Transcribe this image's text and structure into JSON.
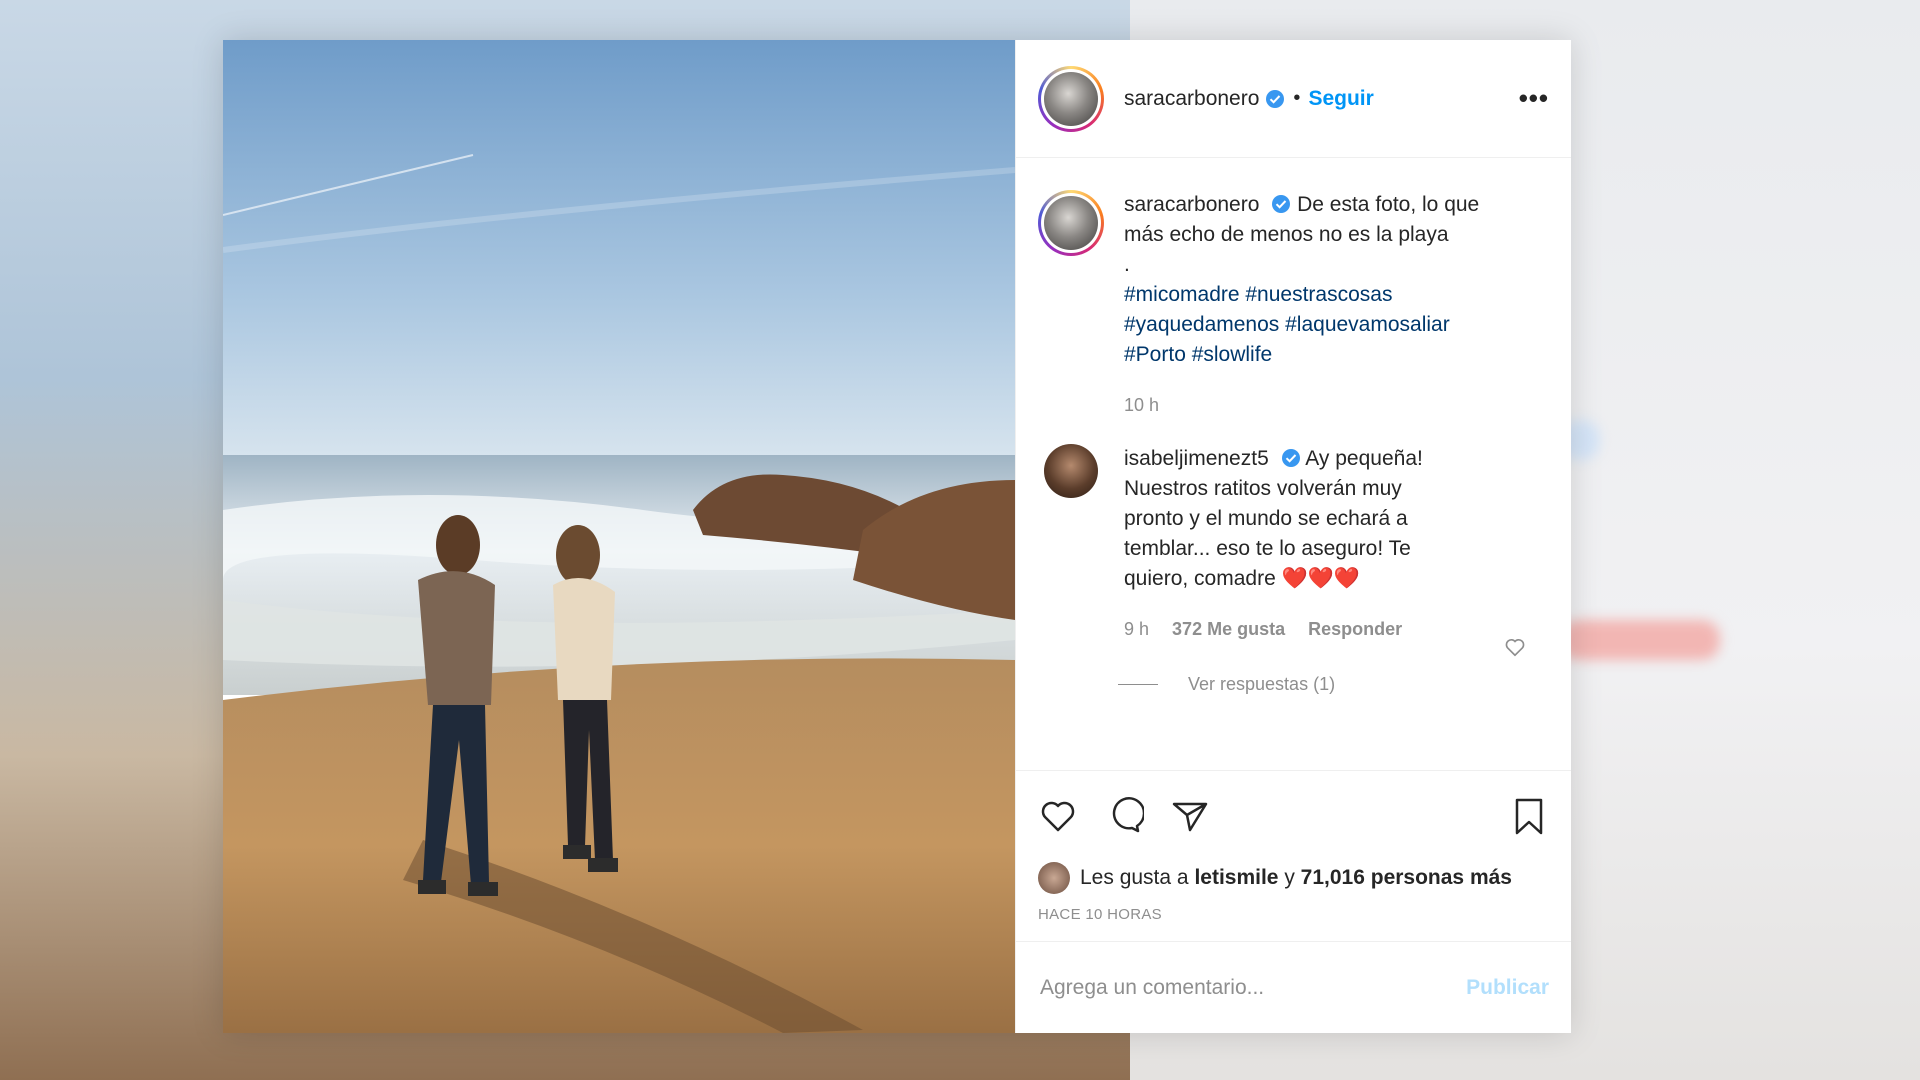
{
  "post": {
    "username": "saracarbonero",
    "separator": "•",
    "follow_label": "Seguir",
    "more_label": "•••",
    "caption_lines": [
      "De esta foto, lo que",
      "más echo de menos no es la playa",
      "."
    ],
    "hashtags": [
      "#micomadre #nuestrascosas",
      "#yaquedamenos #laquevamosaliar",
      "#Porto #slowlife"
    ],
    "caption_time": "10 h"
  },
  "comment1": {
    "username": "isabeljimenezt5",
    "text": "Ay pequeña! Nuestros ratitos volverán muy pronto y el mundo se echará a temblar... eso te lo aseguro! Te quiero, comadre",
    "emojis": "❤️❤️❤️",
    "time": "9 h",
    "likes": "372 Me gusta",
    "reply_label": "Responder",
    "view_replies": "Ver respuestas (1)"
  },
  "likes": {
    "prefix": "Les gusta a",
    "user": "letismile",
    "middle": "y",
    "count": "71,016 personas más"
  },
  "time_ago": "HACE 10 HORAS",
  "comment_box": {
    "placeholder": "Agrega un comentario...",
    "publish_label": "Publicar"
  },
  "colors": {
    "accent": "#0095f6",
    "verified": "#3897f0",
    "hashtag": "#00376b",
    "muted": "#8e8e8e"
  },
  "icons": [
    "verified-badge-icon",
    "heart-icon",
    "comment-icon",
    "share-icon",
    "bookmark-icon",
    "like-heart-small-icon",
    "more-options-icon"
  ]
}
